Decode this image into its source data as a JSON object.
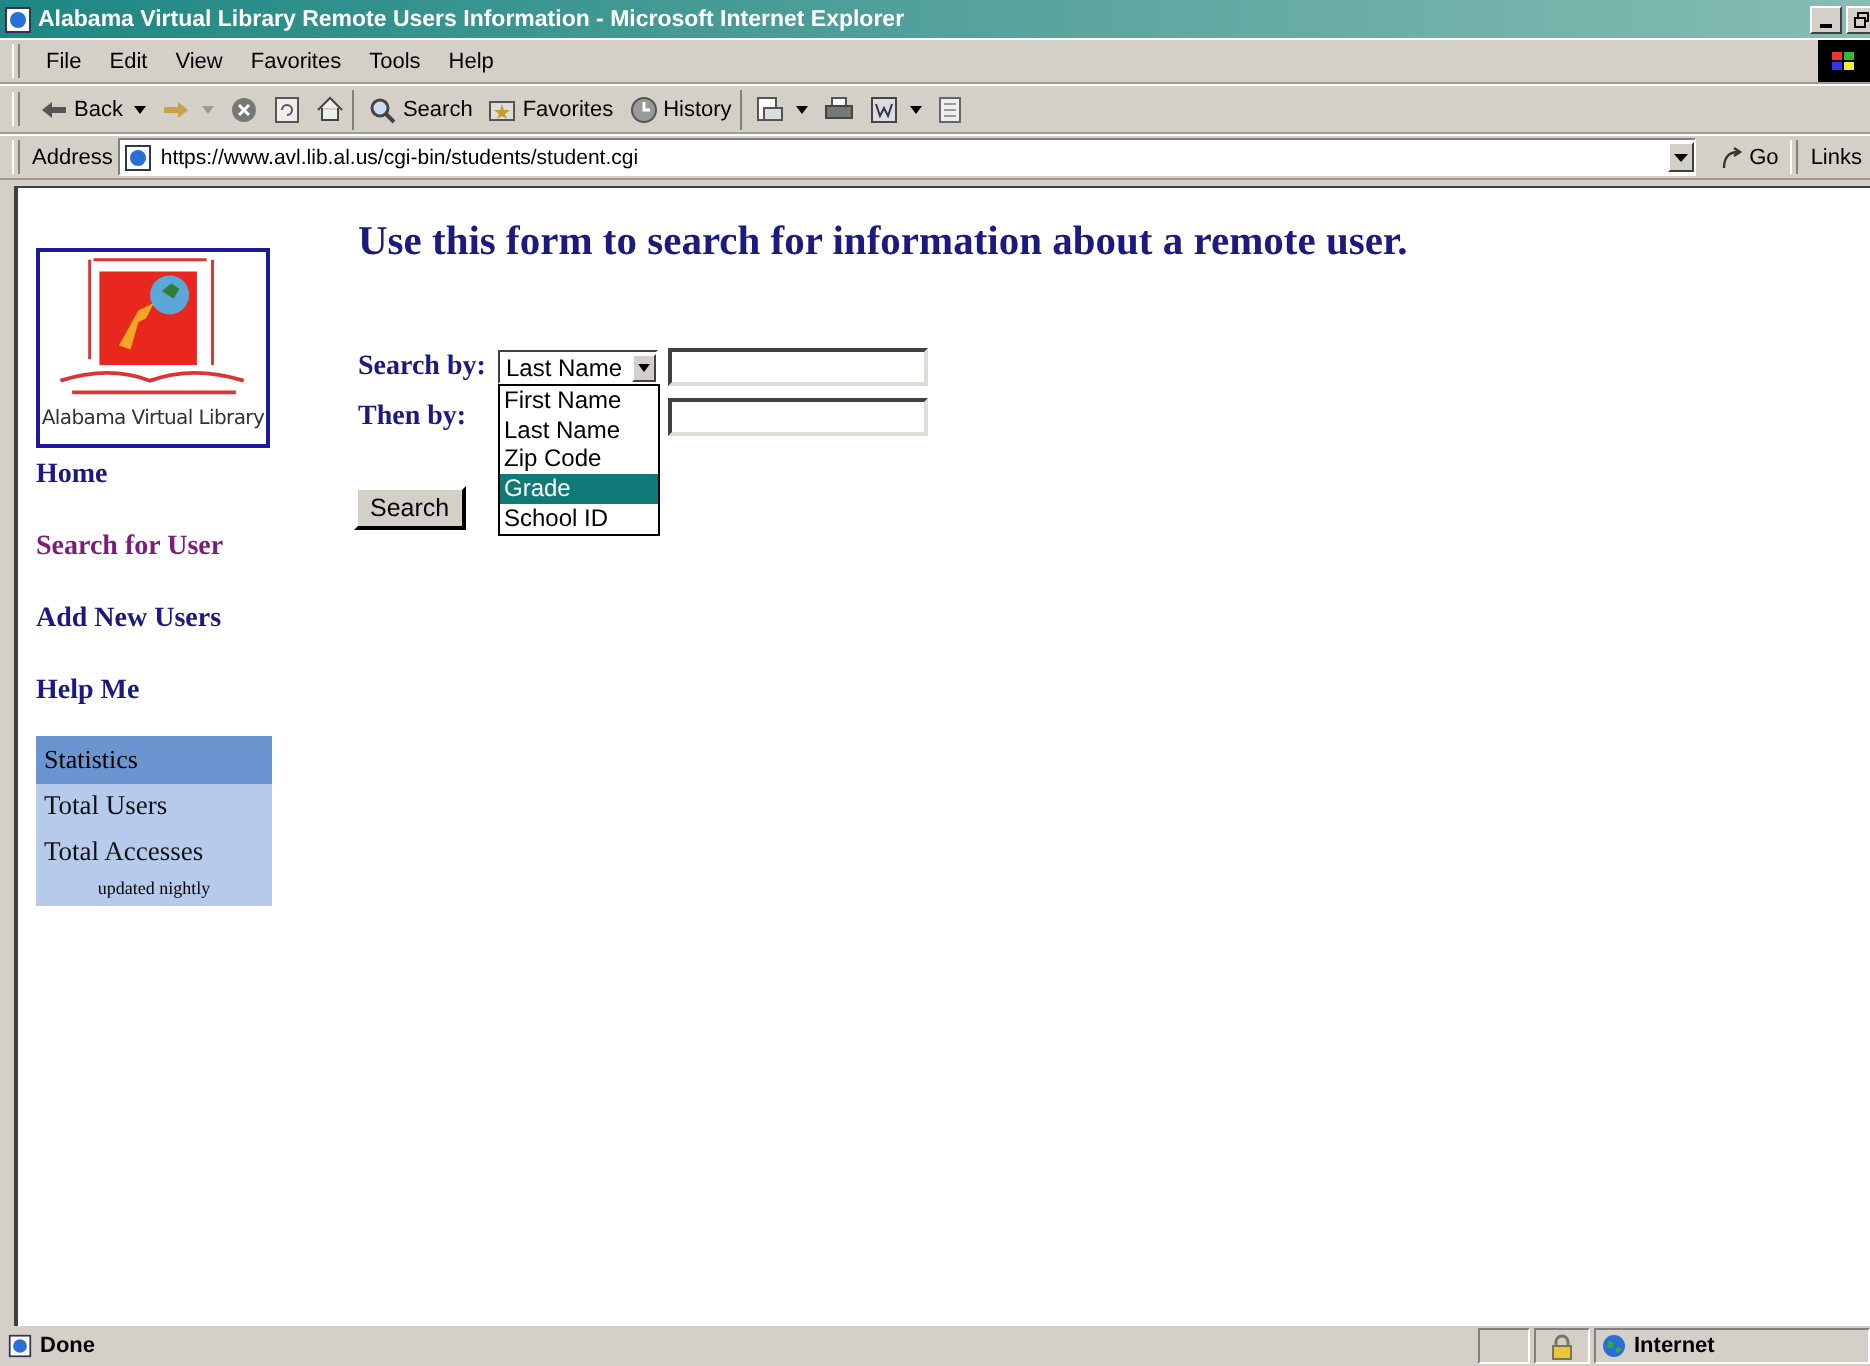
{
  "window": {
    "title": "Alabama Virtual Library Remote Users Information - Microsoft Internet Explorer"
  },
  "menu": [
    "File",
    "Edit",
    "View",
    "Favorites",
    "Tools",
    "Help"
  ],
  "toolbar": [
    {
      "kind": "back",
      "label": "Back"
    },
    {
      "kind": "forward"
    },
    {
      "kind": "stop"
    },
    {
      "kind": "refresh"
    },
    {
      "kind": "home"
    },
    {
      "kind": "search",
      "label": "Search"
    },
    {
      "kind": "favorites",
      "label": "Favorites"
    },
    {
      "kind": "history",
      "label": "History"
    },
    {
      "kind": "mail"
    },
    {
      "kind": "print"
    },
    {
      "kind": "edit"
    },
    {
      "kind": "discuss"
    }
  ],
  "address": {
    "label": "Address",
    "url": "https://www.avl.lib.al.us/cgi-bin/students/student.cgi",
    "go": "Go",
    "links": "Links"
  },
  "sidebar": {
    "logo_caption": "Alabama Virtual Library",
    "links": [
      {
        "label": "Home",
        "visited": false
      },
      {
        "label": "Search for User",
        "visited": true
      },
      {
        "label": "Add New Users",
        "visited": false
      },
      {
        "label": "Help Me",
        "visited": false
      }
    ],
    "stats": {
      "header": "Statistics",
      "items": [
        "Total Users",
        "Total Accesses"
      ],
      "note": "updated nightly"
    }
  },
  "heading": "Use this form to search for information about a remote user.",
  "form": {
    "search_by_label": "Search by:",
    "search_by_value": "Last Name",
    "then_by_label": "Then by:",
    "options": [
      {
        "label": "First Name",
        "selected": false
      },
      {
        "label": "Last Name",
        "selected": false
      },
      {
        "label": "Zip Code",
        "selected": false
      },
      {
        "label": "Grade",
        "selected": true
      },
      {
        "label": "School ID",
        "selected": false
      }
    ],
    "button": "Search"
  },
  "status_bar": {
    "text": "Done",
    "zone": "Internet"
  }
}
